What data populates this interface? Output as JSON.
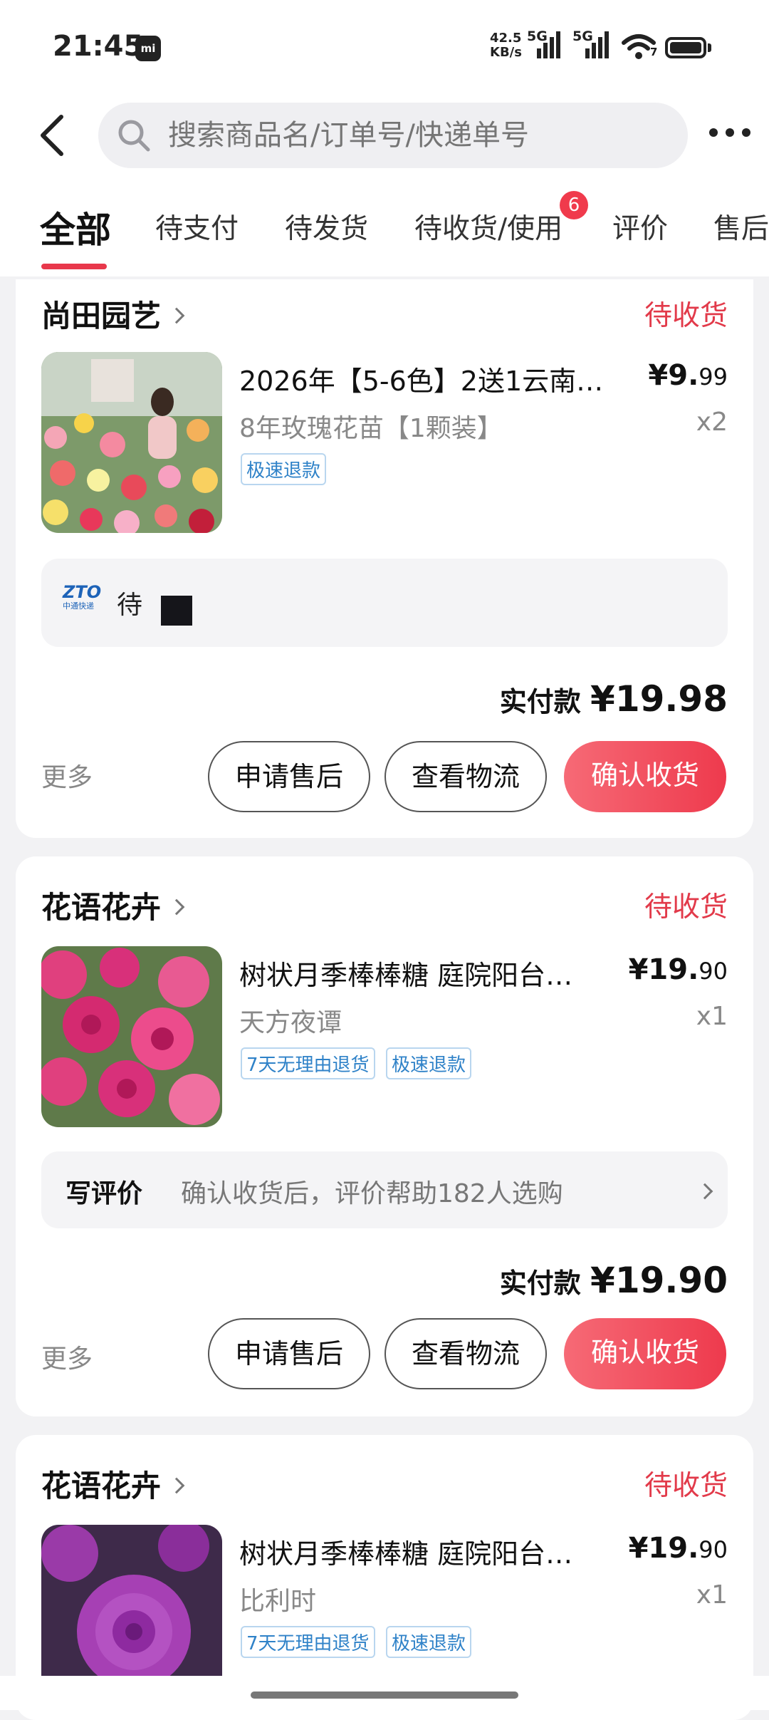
{
  "status_bar": {
    "time": "21:45",
    "mi_badge": "mi",
    "net_speed_value": "42.5",
    "net_speed_unit": "KB/s",
    "net_type_1": "5G",
    "net_type_2": "5G",
    "wifi_sub": "7"
  },
  "search": {
    "placeholder": "搜索商品名/订单号/快递单号"
  },
  "tabs": [
    {
      "label": "全部",
      "active": true
    },
    {
      "label": "待支付"
    },
    {
      "label": "待发货"
    },
    {
      "label": "待收货/使用",
      "badge": "6"
    },
    {
      "label": "评价"
    },
    {
      "label": "售后"
    }
  ],
  "orders": [
    {
      "shop": "尚田园艺",
      "status": "待收货",
      "title": "2026年【5-6色】2送1云南…",
      "spec": "8年玫瑰花苗【1颗装】",
      "price_int": "¥9.",
      "price_dec": "99",
      "qty": "x2",
      "tags": [
        "极速退款"
      ],
      "logistics_logo": "ZTO",
      "logistics_logo_sub": "中通快递",
      "logistics_text": "待",
      "paid_label": "实付款",
      "paid_amount": "¥19.98",
      "more": "更多",
      "btn_after_sale": "申请售后",
      "btn_logistics": "查看物流",
      "btn_confirm": "确认收货"
    },
    {
      "shop": "花语花卉",
      "status": "待收货",
      "title": "树状月季棒棒糖 庭院阳台…",
      "spec": "天方夜谭",
      "price_int": "¥19.",
      "price_dec": "90",
      "qty": "x1",
      "tags": [
        "7天无理由退货",
        "极速退款"
      ],
      "review_label": "写评价",
      "review_text": "确认收货后，评价帮助182人选购",
      "paid_label": "实付款",
      "paid_amount": "¥19.90",
      "more": "更多",
      "btn_after_sale": "申请售后",
      "btn_logistics": "查看物流",
      "btn_confirm": "确认收货"
    },
    {
      "shop": "花语花卉",
      "status": "待收货",
      "title": "树状月季棒棒糖 庭院阳台…",
      "spec": "比利时",
      "price_int": "¥19.",
      "price_dec": "90",
      "qty": "x1",
      "tags": [
        "7天无理由退货",
        "极速退款"
      ]
    }
  ],
  "colors": {
    "accent": "#e23a4a",
    "button_gradient_start": "#f66a76",
    "button_gradient_end": "#ee3a4d",
    "tag_blue": "#2f82c8",
    "page_bg": "#f2f2f4"
  }
}
